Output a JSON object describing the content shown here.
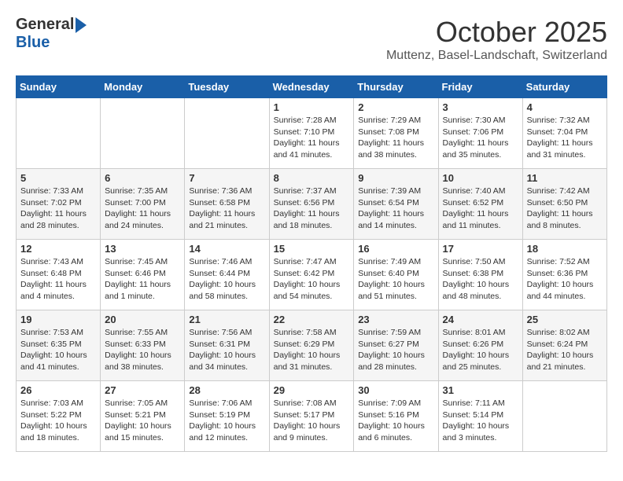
{
  "header": {
    "logo_general": "General",
    "logo_blue": "Blue",
    "month": "October 2025",
    "location": "Muttenz, Basel-Landschaft, Switzerland"
  },
  "weekdays": [
    "Sunday",
    "Monday",
    "Tuesday",
    "Wednesday",
    "Thursday",
    "Friday",
    "Saturday"
  ],
  "weeks": [
    [
      {
        "day": "",
        "info": ""
      },
      {
        "day": "",
        "info": ""
      },
      {
        "day": "",
        "info": ""
      },
      {
        "day": "1",
        "info": "Sunrise: 7:28 AM\nSunset: 7:10 PM\nDaylight: 11 hours\nand 41 minutes."
      },
      {
        "day": "2",
        "info": "Sunrise: 7:29 AM\nSunset: 7:08 PM\nDaylight: 11 hours\nand 38 minutes."
      },
      {
        "day": "3",
        "info": "Sunrise: 7:30 AM\nSunset: 7:06 PM\nDaylight: 11 hours\nand 35 minutes."
      },
      {
        "day": "4",
        "info": "Sunrise: 7:32 AM\nSunset: 7:04 PM\nDaylight: 11 hours\nand 31 minutes."
      }
    ],
    [
      {
        "day": "5",
        "info": "Sunrise: 7:33 AM\nSunset: 7:02 PM\nDaylight: 11 hours\nand 28 minutes."
      },
      {
        "day": "6",
        "info": "Sunrise: 7:35 AM\nSunset: 7:00 PM\nDaylight: 11 hours\nand 24 minutes."
      },
      {
        "day": "7",
        "info": "Sunrise: 7:36 AM\nSunset: 6:58 PM\nDaylight: 11 hours\nand 21 minutes."
      },
      {
        "day": "8",
        "info": "Sunrise: 7:37 AM\nSunset: 6:56 PM\nDaylight: 11 hours\nand 18 minutes."
      },
      {
        "day": "9",
        "info": "Sunrise: 7:39 AM\nSunset: 6:54 PM\nDaylight: 11 hours\nand 14 minutes."
      },
      {
        "day": "10",
        "info": "Sunrise: 7:40 AM\nSunset: 6:52 PM\nDaylight: 11 hours\nand 11 minutes."
      },
      {
        "day": "11",
        "info": "Sunrise: 7:42 AM\nSunset: 6:50 PM\nDaylight: 11 hours\nand 8 minutes."
      }
    ],
    [
      {
        "day": "12",
        "info": "Sunrise: 7:43 AM\nSunset: 6:48 PM\nDaylight: 11 hours\nand 4 minutes."
      },
      {
        "day": "13",
        "info": "Sunrise: 7:45 AM\nSunset: 6:46 PM\nDaylight: 11 hours\nand 1 minute."
      },
      {
        "day": "14",
        "info": "Sunrise: 7:46 AM\nSunset: 6:44 PM\nDaylight: 10 hours\nand 58 minutes."
      },
      {
        "day": "15",
        "info": "Sunrise: 7:47 AM\nSunset: 6:42 PM\nDaylight: 10 hours\nand 54 minutes."
      },
      {
        "day": "16",
        "info": "Sunrise: 7:49 AM\nSunset: 6:40 PM\nDaylight: 10 hours\nand 51 minutes."
      },
      {
        "day": "17",
        "info": "Sunrise: 7:50 AM\nSunset: 6:38 PM\nDaylight: 10 hours\nand 48 minutes."
      },
      {
        "day": "18",
        "info": "Sunrise: 7:52 AM\nSunset: 6:36 PM\nDaylight: 10 hours\nand 44 minutes."
      }
    ],
    [
      {
        "day": "19",
        "info": "Sunrise: 7:53 AM\nSunset: 6:35 PM\nDaylight: 10 hours\nand 41 minutes."
      },
      {
        "day": "20",
        "info": "Sunrise: 7:55 AM\nSunset: 6:33 PM\nDaylight: 10 hours\nand 38 minutes."
      },
      {
        "day": "21",
        "info": "Sunrise: 7:56 AM\nSunset: 6:31 PM\nDaylight: 10 hours\nand 34 minutes."
      },
      {
        "day": "22",
        "info": "Sunrise: 7:58 AM\nSunset: 6:29 PM\nDaylight: 10 hours\nand 31 minutes."
      },
      {
        "day": "23",
        "info": "Sunrise: 7:59 AM\nSunset: 6:27 PM\nDaylight: 10 hours\nand 28 minutes."
      },
      {
        "day": "24",
        "info": "Sunrise: 8:01 AM\nSunset: 6:26 PM\nDaylight: 10 hours\nand 25 minutes."
      },
      {
        "day": "25",
        "info": "Sunrise: 8:02 AM\nSunset: 6:24 PM\nDaylight: 10 hours\nand 21 minutes."
      }
    ],
    [
      {
        "day": "26",
        "info": "Sunrise: 7:03 AM\nSunset: 5:22 PM\nDaylight: 10 hours\nand 18 minutes."
      },
      {
        "day": "27",
        "info": "Sunrise: 7:05 AM\nSunset: 5:21 PM\nDaylight: 10 hours\nand 15 minutes."
      },
      {
        "day": "28",
        "info": "Sunrise: 7:06 AM\nSunset: 5:19 PM\nDaylight: 10 hours\nand 12 minutes."
      },
      {
        "day": "29",
        "info": "Sunrise: 7:08 AM\nSunset: 5:17 PM\nDaylight: 10 hours\nand 9 minutes."
      },
      {
        "day": "30",
        "info": "Sunrise: 7:09 AM\nSunset: 5:16 PM\nDaylight: 10 hours\nand 6 minutes."
      },
      {
        "day": "31",
        "info": "Sunrise: 7:11 AM\nSunset: 5:14 PM\nDaylight: 10 hours\nand 3 minutes."
      },
      {
        "day": "",
        "info": ""
      }
    ]
  ]
}
